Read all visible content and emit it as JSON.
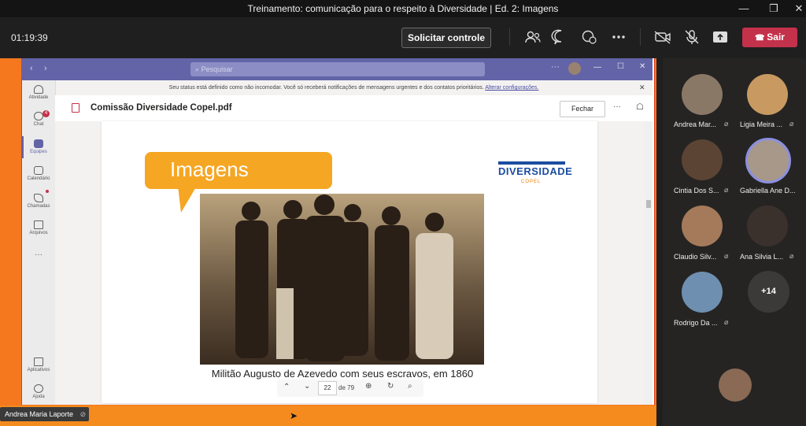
{
  "window": {
    "title": "Treinamento: comunicação para o respeito à Diversidade | Ed. 2: Imagens"
  },
  "toolbar": {
    "timer": "01:19:39",
    "request_control": "Solicitar controle",
    "leave": "Sair"
  },
  "inner_teams": {
    "search_placeholder": "Pesquisar",
    "banner_text": "Seu status está definido como não incomodar. Você só receberá notificações de mensagens urgentes e dos contatos prioritários.",
    "banner_link": "Alterar configurações.",
    "rail": [
      {
        "label": "Atividade",
        "icon": "bell-icon"
      },
      {
        "label": "Chat",
        "icon": "chat-icon",
        "badge": "4"
      },
      {
        "label": "Equipes",
        "icon": "teams-icon"
      },
      {
        "label": "Calendário",
        "icon": "calendar-icon"
      },
      {
        "label": "Chamadas",
        "icon": "phone-icon"
      },
      {
        "label": "Arquivos",
        "icon": "file-icon"
      },
      {
        "label": "Aplicativos",
        "icon": "apps-icon"
      },
      {
        "label": "Ajuda",
        "icon": "help-icon"
      }
    ],
    "doc_name": "Comissão Diversidade Copel.pdf",
    "close_label": "Fechar"
  },
  "slide": {
    "heading": "Imagens",
    "brand": "DIVERSIDADE",
    "brand_sub": "COPEL",
    "caption": "Militão Augusto de Azevedo com seus escravos, em 1860"
  },
  "pager": {
    "current": "22",
    "total_label": "de 79"
  },
  "presenter": {
    "name": "Andrea Maria Laporte"
  },
  "participants": [
    {
      "name": "Andrea Mar...",
      "muted": true
    },
    {
      "name": "Ligia Meira ...",
      "muted": true
    },
    {
      "name": "Cintia Dos S...",
      "muted": true
    },
    {
      "name": "Gabriella Ane D...",
      "muted": false,
      "speaking": true
    },
    {
      "name": "Claudio Silv...",
      "muted": true
    },
    {
      "name": "Ana Silvia L...",
      "muted": true
    },
    {
      "name": "Rodrigo Da ...",
      "muted": true
    }
  ],
  "more_participants": "+14",
  "colors": {
    "accent": "#6264a7",
    "leave": "#c4314b",
    "stage": "#f5781f",
    "slide_orange": "#f5a623",
    "brand_blue": "#1b4da0"
  }
}
